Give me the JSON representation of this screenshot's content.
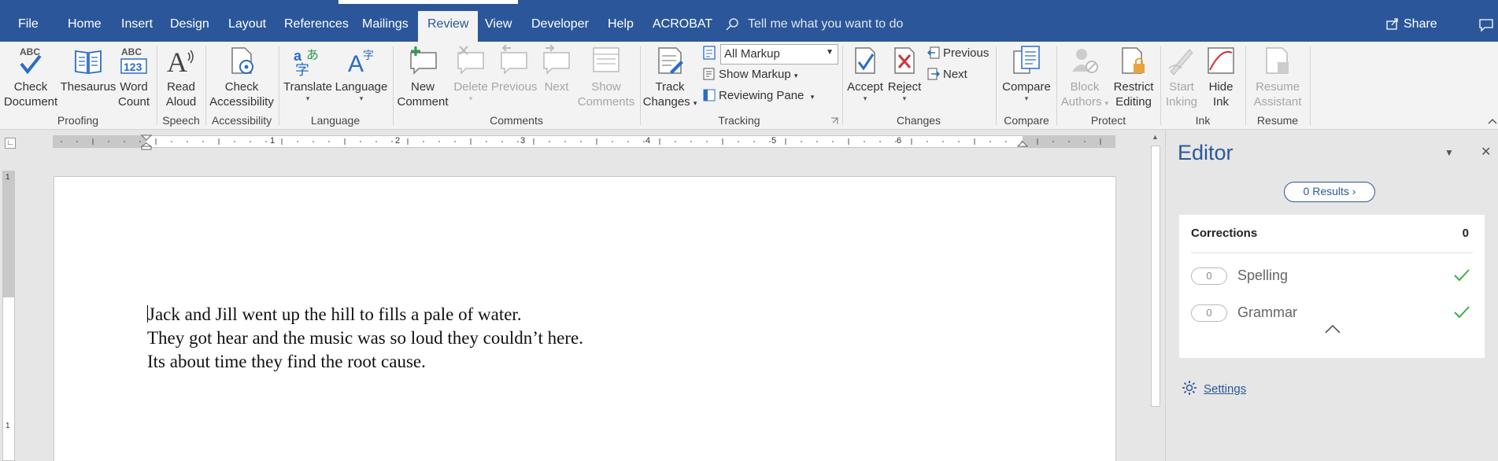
{
  "tabs": {
    "file": "File",
    "home": "Home",
    "insert": "Insert",
    "design": "Design",
    "layout": "Layout",
    "references": "References",
    "mailings": "Mailings",
    "review": "Review",
    "view": "View",
    "developer": "Developer",
    "help": "Help",
    "acrobat": "ACROBAT",
    "tell_me": "Tell me what you want to do",
    "share": "Share"
  },
  "ribbon": {
    "proofing": {
      "check_document": [
        "Check",
        "Document"
      ],
      "thesaurus": "Thesaurus",
      "word_count": [
        "Word",
        "Count"
      ],
      "label": "Proofing"
    },
    "speech": {
      "read_aloud": [
        "Read",
        "Aloud"
      ],
      "label": "Speech"
    },
    "accessibility": {
      "check_accessibility": [
        "Check",
        "Accessibility"
      ],
      "label": "Accessibility"
    },
    "language": {
      "translate": "Translate",
      "language": "Language",
      "label": "Language"
    },
    "comments": {
      "new_comment": [
        "New",
        "Comment"
      ],
      "delete": "Delete",
      "previous": "Previous",
      "next": "Next",
      "show_comments": [
        "Show",
        "Comments"
      ],
      "label": "Comments"
    },
    "tracking": {
      "track_changes": [
        "Track",
        "Changes"
      ],
      "markup_value": "All Markup",
      "show_markup": "Show Markup",
      "reviewing_pane": "Reviewing Pane",
      "label": "Tracking"
    },
    "changes": {
      "accept": "Accept",
      "reject": "Reject",
      "previous": "Previous",
      "next": "Next",
      "label": "Changes"
    },
    "compare": {
      "compare": "Compare",
      "label": "Compare"
    },
    "protect": {
      "block_authors": [
        "Block",
        "Authors"
      ],
      "restrict_editing": [
        "Restrict",
        "Editing"
      ],
      "label": "Protect"
    },
    "ink": {
      "start_inking": [
        "Start",
        "Inking"
      ],
      "hide_ink": [
        "Hide",
        "Ink"
      ],
      "label": "Ink"
    },
    "resume": {
      "resume_assistant": [
        "Resume",
        "Assistant"
      ],
      "label": "Resume"
    }
  },
  "ruler": {
    "numbers": [
      "1",
      "2",
      "3",
      "4",
      "5",
      "6"
    ],
    "v_number": "1"
  },
  "document": {
    "lines": [
      "Jack and Jill went up the hill to fills a pale of water.",
      "They got hear and the music was so loud they couldn’t here.",
      "Its about time they find the root cause."
    ]
  },
  "editor": {
    "title": "Editor",
    "results_label": "0 Results",
    "corrections_label": "Corrections",
    "corrections_count": "0",
    "items": [
      {
        "count": "0",
        "label": "Spelling"
      },
      {
        "count": "0",
        "label": "Grammar"
      }
    ],
    "settings_label": "Settings"
  },
  "colors": {
    "word_blue": "#2b579a",
    "ribbon_bg": "#f3f3f3",
    "check_green": "#3fae49"
  }
}
